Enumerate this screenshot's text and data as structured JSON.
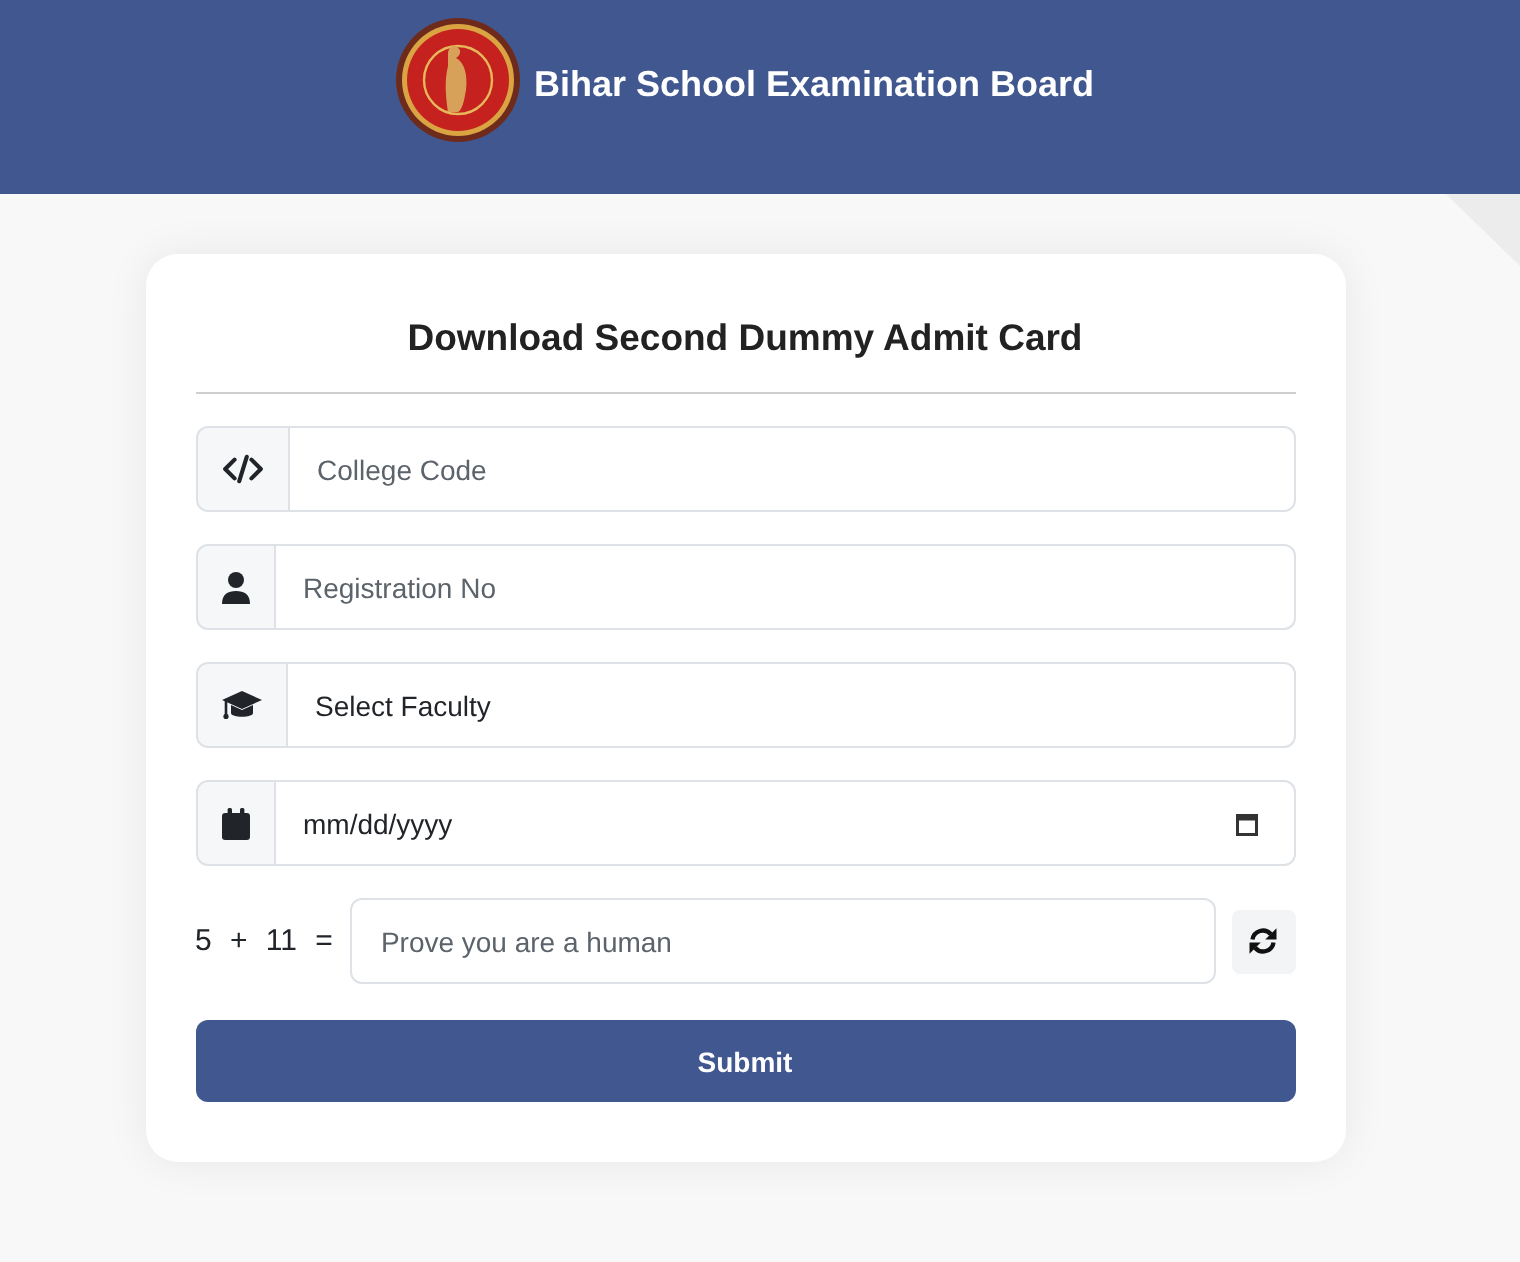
{
  "header": {
    "title": "Bihar School Examination Board"
  },
  "form": {
    "title": "Download Second Dummy Admit Card",
    "fields": [
      {
        "kind": "text",
        "placeholder": "College Code"
      },
      {
        "kind": "text",
        "placeholder": "Registration No"
      },
      {
        "kind": "select",
        "value": "Select Faculty"
      },
      {
        "kind": "date",
        "value": "mm/dd/yyyy"
      }
    ],
    "captcha": {
      "question": "5 + 11 =",
      "placeholder": "Prove you are a human"
    },
    "submit_button": "Submit"
  }
}
